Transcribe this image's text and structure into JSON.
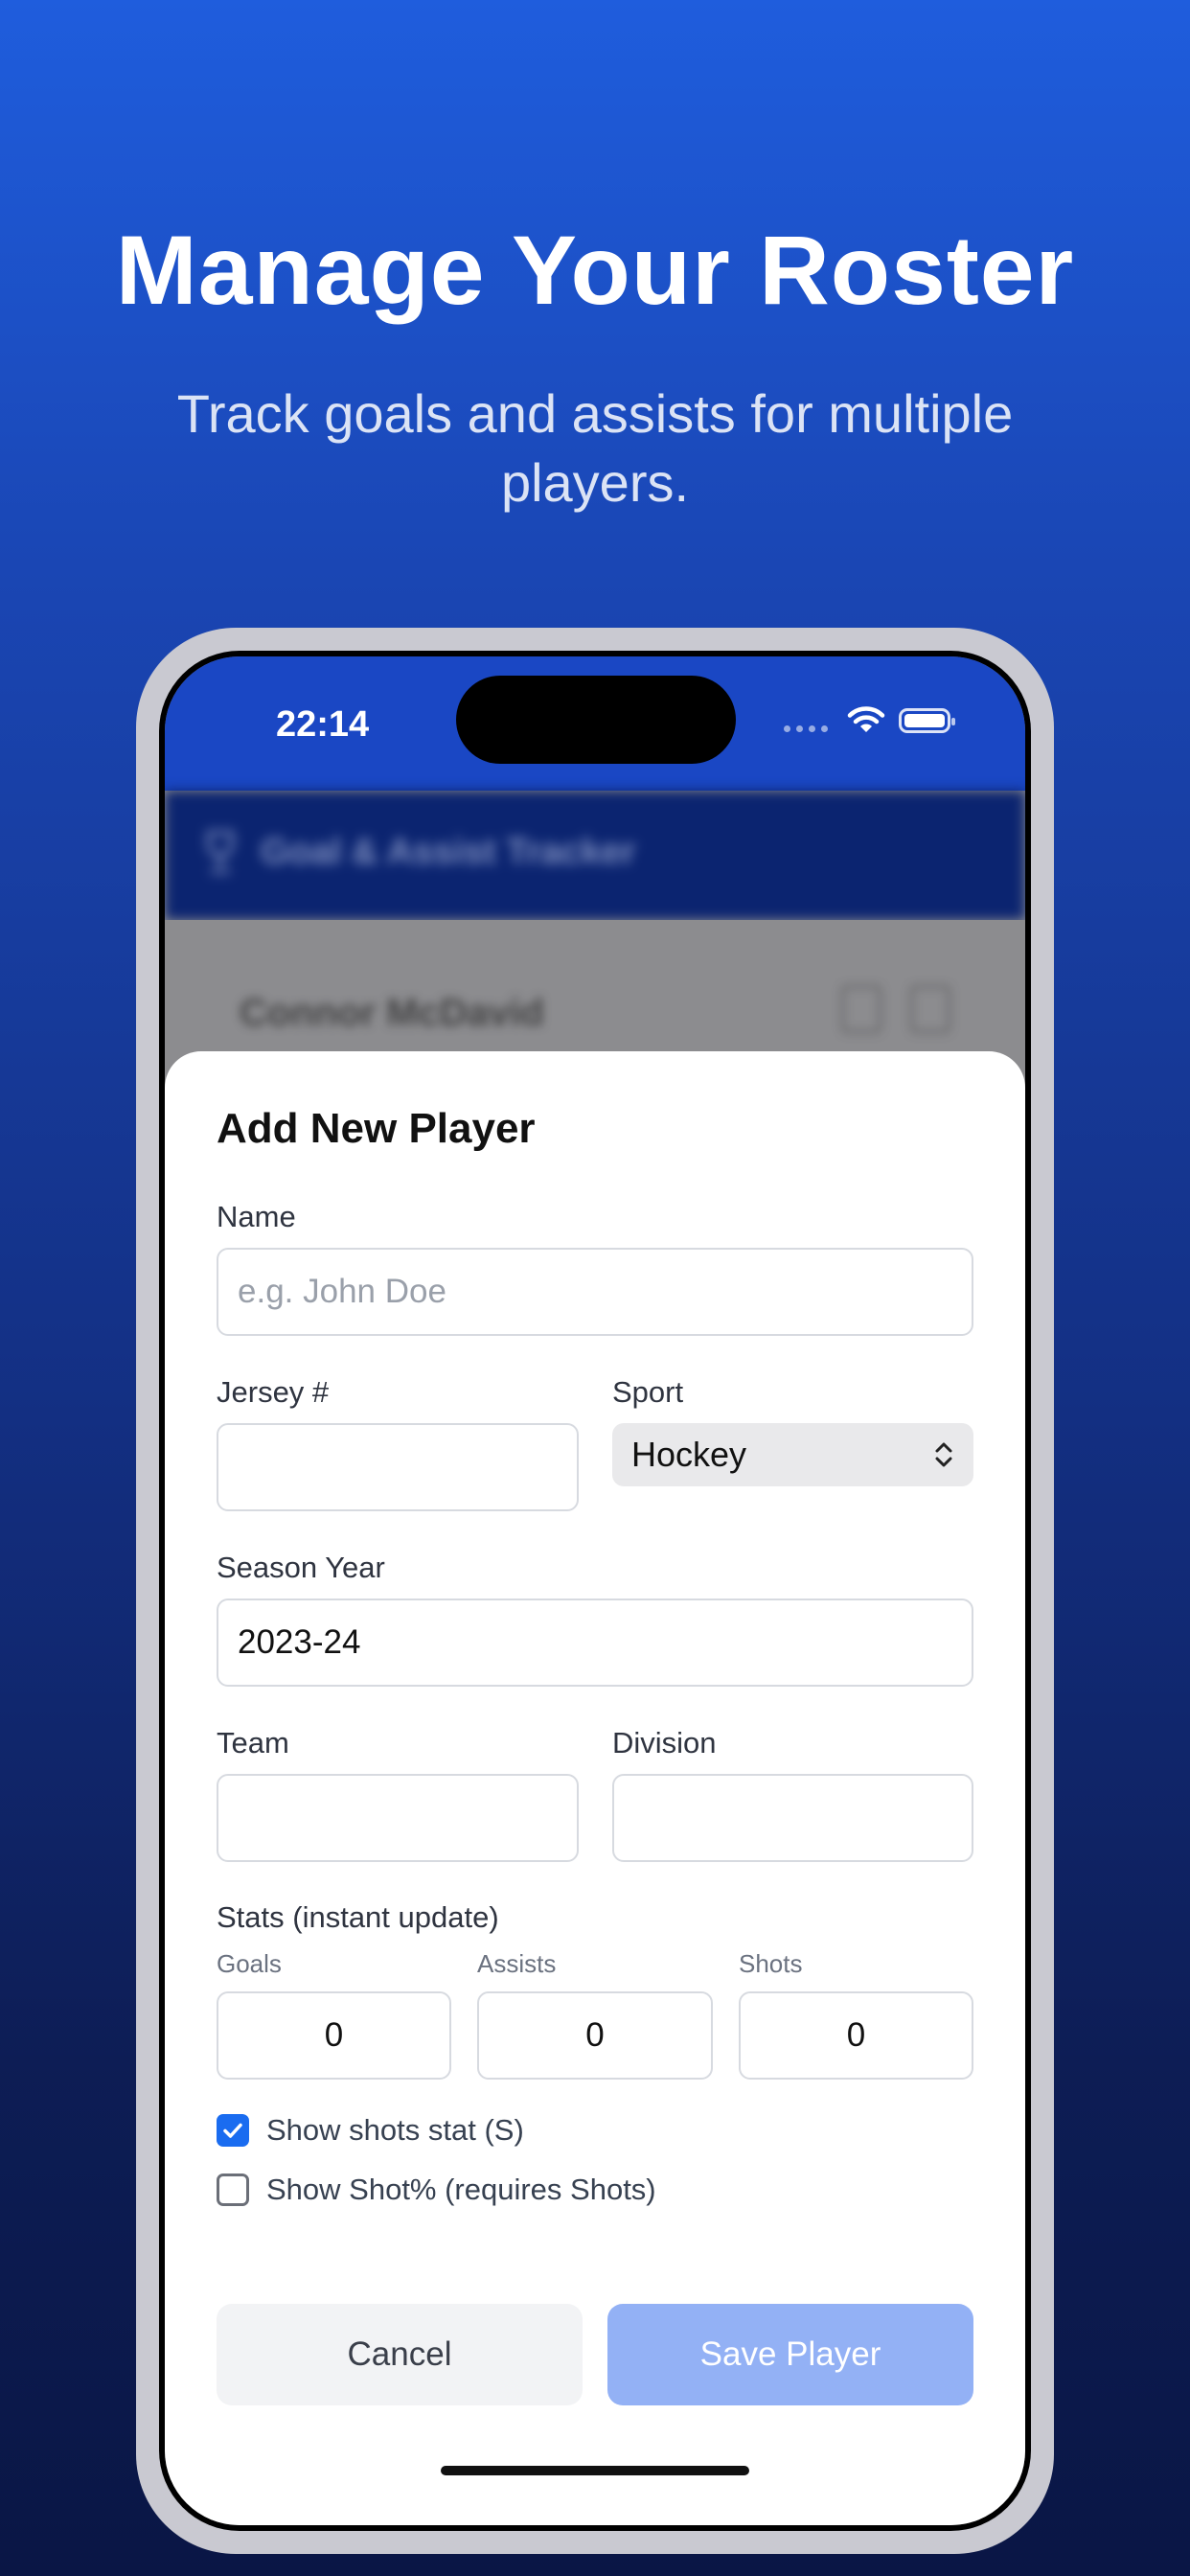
{
  "marketing": {
    "headline": "Manage Your Roster",
    "subheadline": "Track goals and assists for multiple players."
  },
  "status_bar": {
    "time": "22:14"
  },
  "background_app": {
    "title": "Goal & Assist Tracker",
    "first_player": "Connor McDavid"
  },
  "form": {
    "title": "Add New Player",
    "name_label": "Name",
    "name_placeholder": "e.g. John Doe",
    "name_value": "",
    "jersey_label": "Jersey #",
    "jersey_value": "",
    "sport_label": "Sport",
    "sport_value": "Hockey",
    "season_label": "Season Year",
    "season_value": "2023-24",
    "team_label": "Team",
    "team_value": "",
    "division_label": "Division",
    "division_value": "",
    "stats_label": "Stats (instant update)",
    "goals_label": "Goals",
    "goals_value": "0",
    "assists_label": "Assists",
    "assists_value": "0",
    "shots_label": "Shots",
    "shots_value": "0",
    "show_shots_label": "Show shots stat (S)",
    "show_shots_checked": true,
    "show_shot_pct_label": "Show Shot% (requires Shots)",
    "show_shot_pct_checked": false,
    "cancel_label": "Cancel",
    "save_label": "Save Player"
  },
  "colors": {
    "accent": "#1a6cf0",
    "save_disabled": "#93b1f5",
    "status_bar": "#1a47c4"
  }
}
